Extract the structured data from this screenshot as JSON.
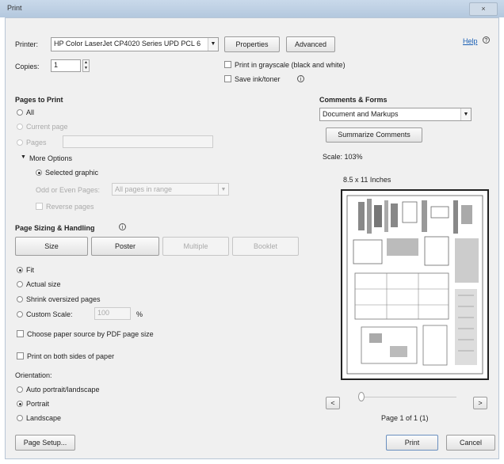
{
  "window": {
    "title": "Print",
    "close_label": "×"
  },
  "printer": {
    "label": "Printer:",
    "value": "HP Color LaserJet CP4020 Series UPD PCL 6",
    "properties_label": "Properties",
    "advanced_label": "Advanced",
    "help_label": "Help",
    "copies_label": "Copies:",
    "copies_value": "1",
    "grayscale_label": "Print in grayscale (black and white)",
    "save_ink_label": "Save ink/toner"
  },
  "pages_to_print": {
    "heading": "Pages to Print",
    "all_label": "All",
    "current_page_label": "Current page",
    "pages_label": "Pages",
    "more_options_label": "More Options",
    "selected_graphic_label": "Selected graphic",
    "odd_even_label": "Odd or Even Pages:",
    "odd_even_value": "All pages in range",
    "reverse_label": "Reverse pages"
  },
  "sizing": {
    "heading": "Page Sizing & Handling",
    "tabs": [
      "Size",
      "Poster",
      "Multiple",
      "Booklet"
    ],
    "fit_label": "Fit",
    "actual_size_label": "Actual size",
    "shrink_label": "Shrink oversized pages",
    "custom_scale_label": "Custom Scale:",
    "custom_scale_value": "100",
    "percent": "%",
    "paper_source_label": "Choose paper source by PDF page size"
  },
  "duplex_label": "Print on both sides of paper",
  "orientation": {
    "heading": "Orientation:",
    "auto_label": "Auto portrait/landscape",
    "portrait_label": "Portrait",
    "landscape_label": "Landscape"
  },
  "comments": {
    "heading": "Comments & Forms",
    "value": "Document and Markups",
    "summarize_label": "Summarize Comments",
    "scale_text": "Scale: 103%",
    "page_size_text": "8.5 x 11 Inches",
    "page_counter": "Page 1 of 1 (1)",
    "prev_label": "<",
    "next_label": ">"
  },
  "footer": {
    "page_setup_label": "Page Setup...",
    "print_label": "Print",
    "cancel_label": "Cancel"
  }
}
